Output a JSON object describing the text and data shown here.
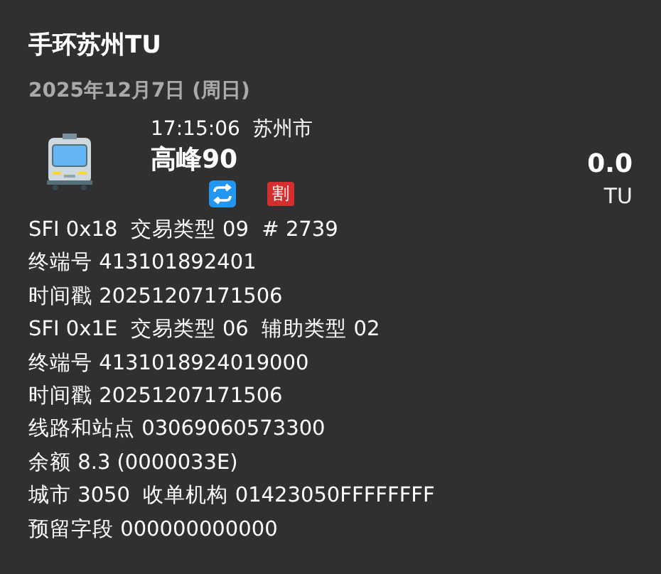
{
  "title": "手环苏州TU",
  "date": "2025年12月7日 (周日)",
  "trip": {
    "time": "17:15:06",
    "city": "苏州市",
    "line": "高峰90",
    "amount": "0.0",
    "currency": "TU",
    "transfer": true,
    "discount_badge": "割"
  },
  "details": [
    "SFI 0x18  交易类型 09  # 2739",
    "终端号 413101892401",
    "时间戳 20251207171506",
    "SFI 0x1E  交易类型 06  辅助类型 02",
    "终端号 4131018924019000",
    "时间戳 20251207171506",
    "线路和站点 03069060573300",
    "余额 8.3 (0000033E)",
    "城市 3050  收单机构 01423050FFFFFFFF",
    "预留字段 000000000000"
  ]
}
